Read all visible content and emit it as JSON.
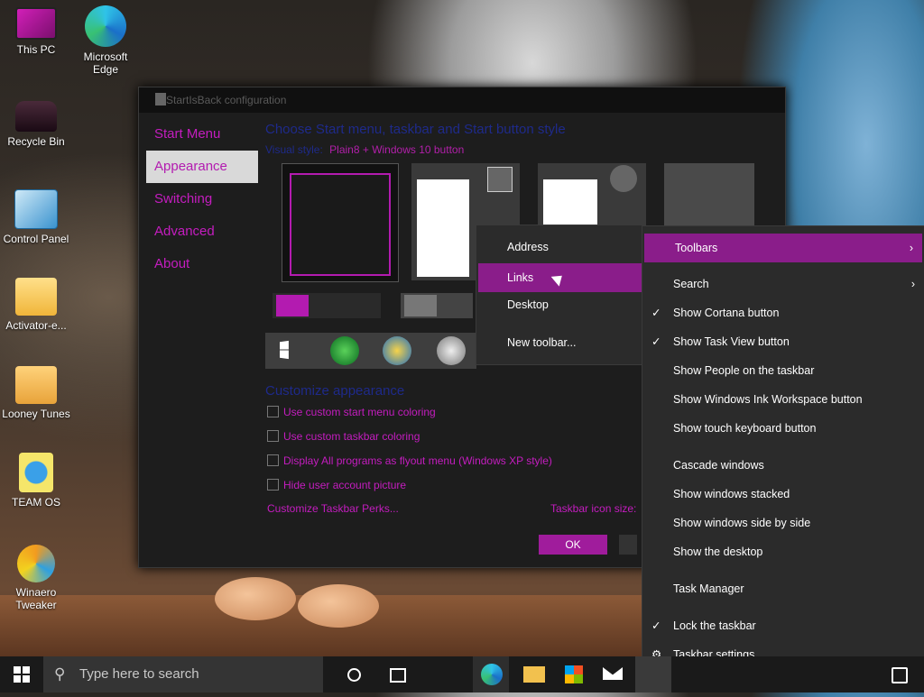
{
  "desktop": {
    "icons": [
      {
        "label": "This PC",
        "icon": "monitor-icon",
        "color": "#b0199f"
      },
      {
        "label": "Microsoft Edge",
        "icon": "edge-icon",
        "color": "#1f8fd6"
      },
      {
        "label": "Recycle Bin",
        "icon": "car-recycle-bin-icon",
        "color": "#3a2030"
      },
      {
        "label": "Control Panel",
        "icon": "control-panel-icon",
        "color": "#4ba3d8"
      },
      {
        "label": "Activator-e...",
        "icon": "folder-icon",
        "color": "#f2c14e"
      },
      {
        "label": "Looney Tunes",
        "icon": "folder-icon",
        "color": "#f2c14e"
      },
      {
        "label": "TEAM OS",
        "icon": "globe-file-icon",
        "color": "#f2e04e"
      },
      {
        "label": "Winaero Tweaker",
        "icon": "edge-tweaker-icon",
        "color": "#e48a1f"
      }
    ]
  },
  "window": {
    "title": "StartIsBack configuration",
    "nav": [
      "Start Menu",
      "Appearance",
      "Switching",
      "Advanced",
      "About"
    ],
    "active_nav": "Appearance",
    "heading": "Choose Start menu, taskbar and Start button style",
    "visual_style_label": "Visual style:",
    "visual_style_value": "Plain8 + Windows 10 button",
    "customize_heading": "Customize appearance",
    "options": [
      "Use custom start menu coloring",
      "Use custom taskbar coloring",
      "Display All programs as flyout menu (Windows XP style)",
      "Hide user account picture"
    ],
    "perks_link": "Customize Taskbar Perks...",
    "icon_size_label": "Taskbar icon size:",
    "ok_label": "OK"
  },
  "toolbars_submenu": {
    "items": [
      "Address",
      "Links",
      "Desktop",
      "New toolbar..."
    ],
    "highlighted": "Links"
  },
  "taskbar_menu": {
    "items": [
      {
        "label": "Toolbars",
        "arrow": true,
        "check": false,
        "highlight": true
      },
      {
        "label": "Search",
        "arrow": true,
        "check": false
      },
      {
        "label": "Show Cortana button",
        "check": true
      },
      {
        "label": "Show Task View button",
        "check": true
      },
      {
        "label": "Show People on the taskbar",
        "check": false
      },
      {
        "label": "Show Windows Ink Workspace button",
        "check": false
      },
      {
        "label": "Show touch keyboard button",
        "check": false
      },
      {
        "label": "Cascade windows",
        "check": false
      },
      {
        "label": "Show windows stacked",
        "check": false
      },
      {
        "label": "Show windows side by side",
        "check": false
      },
      {
        "label": "Show the desktop",
        "check": false
      },
      {
        "label": "Task Manager",
        "check": false
      },
      {
        "label": "Lock the taskbar",
        "check": true
      },
      {
        "label": "Taskbar settings",
        "check": false,
        "gear": true
      }
    ],
    "accent": "#8a1d8a"
  },
  "taskbar": {
    "search_placeholder": "Type here to search",
    "pinned": [
      "edge-icon",
      "file-explorer-icon",
      "store-icon",
      "mail-icon"
    ]
  }
}
